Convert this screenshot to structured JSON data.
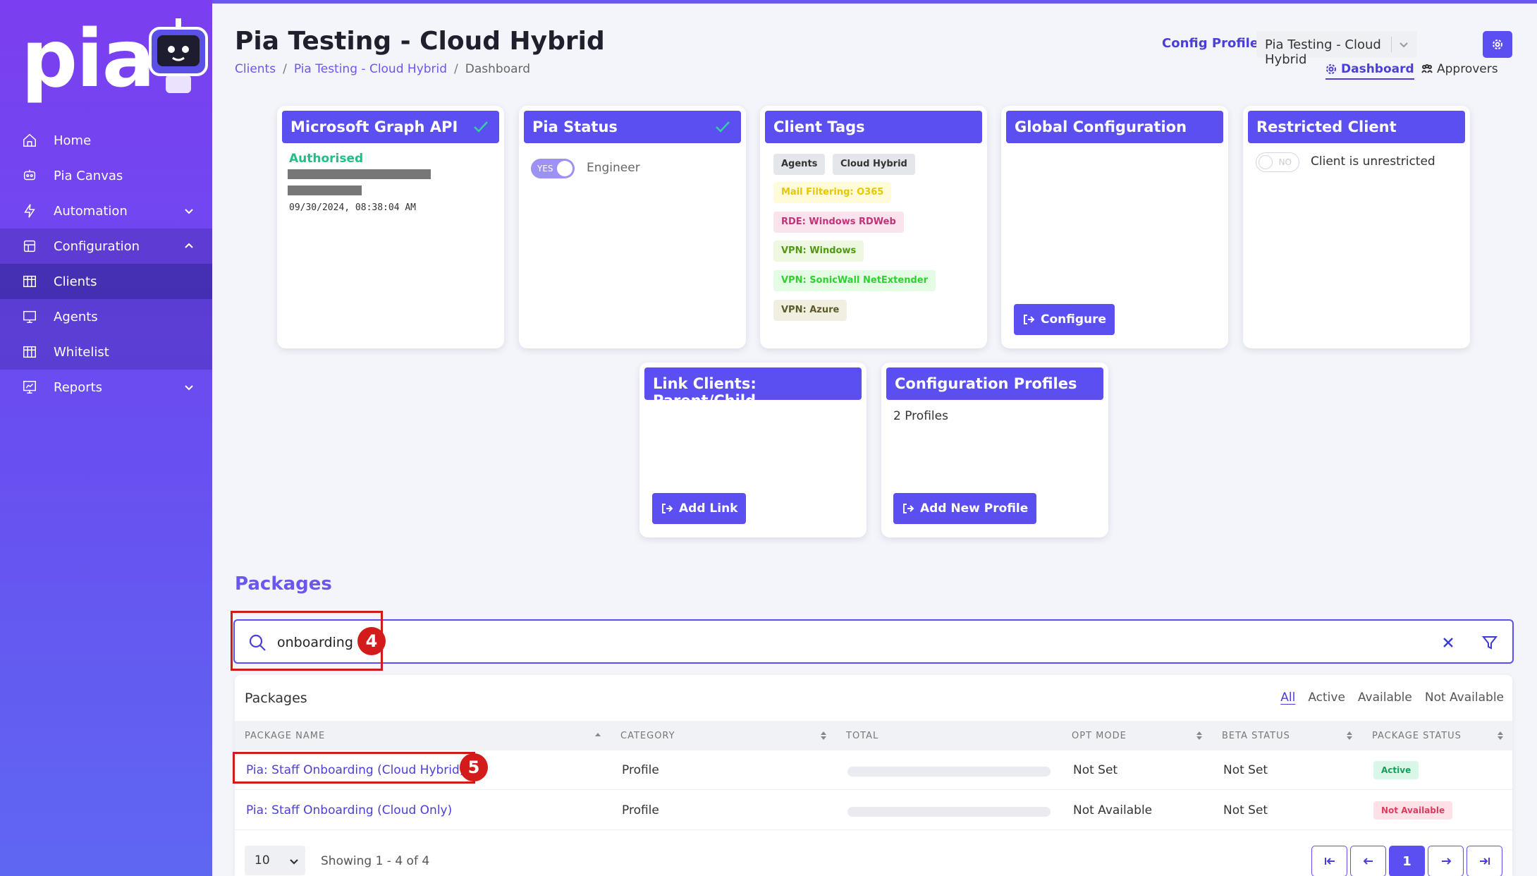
{
  "brand": {
    "logo_text": "pia"
  },
  "sidebar": {
    "items": [
      {
        "label": "Home",
        "icon": "home-icon"
      },
      {
        "label": "Pia Canvas",
        "icon": "canvas-icon"
      },
      {
        "label": "Automation",
        "icon": "bolt-icon",
        "expandable": true
      },
      {
        "label": "Configuration",
        "icon": "config-icon",
        "expanded": true
      },
      {
        "label": "Clients",
        "icon": "grid-icon",
        "active": true
      },
      {
        "label": "Agents",
        "icon": "monitor-icon"
      },
      {
        "label": "Whitelist",
        "icon": "grid-icon"
      },
      {
        "label": "Reports",
        "icon": "report-icon",
        "expandable": true
      }
    ]
  },
  "header": {
    "title": "Pia Testing - Cloud Hybrid",
    "breadcrumb": [
      "Clients",
      "Pia Testing - Cloud Hybrid",
      "Dashboard"
    ],
    "config_profile_label": "Config Profile:",
    "config_profile_value": "Pia Testing - Cloud Hybrid",
    "tabs": [
      "Dashboard",
      "Approvers"
    ]
  },
  "cards": {
    "graph_api": {
      "title": "Microsoft Graph API",
      "status": "Authorised",
      "date": "09/30/2024, 08:38:04 AM"
    },
    "pia_status": {
      "title": "Pia Status",
      "toggle": "YES",
      "role": "Engineer"
    },
    "client_tags": {
      "title": "Client Tags",
      "tags": [
        "Agents",
        "Cloud Hybrid",
        "Mail Filtering: O365",
        "RDE: Windows RDWeb",
        "VPN: Windows",
        "VPN: SonicWall NetExtender",
        "VPN: Azure"
      ]
    },
    "global_config": {
      "title": "Global Configuration",
      "button": "Configure"
    },
    "restricted": {
      "title": "Restricted Client",
      "toggle": "NO",
      "text": "Client is unrestricted"
    },
    "link_clients": {
      "title": "Link Clients: Parent/Child",
      "button": "Add Link"
    },
    "config_profiles": {
      "title": "Configuration Profiles",
      "count": "2 Profiles",
      "button": "Add New Profile"
    }
  },
  "packages": {
    "heading": "Packages",
    "search_value": "onboarding",
    "table_title": "Packages",
    "filters": [
      "All",
      "Active",
      "Available",
      "Not Available"
    ],
    "columns": [
      "Package Name",
      "Category",
      "Total",
      "Opt Mode",
      "Beta Status",
      "Package Status"
    ],
    "rows": [
      {
        "name": "Pia: Staff Onboarding (Cloud Hybrid)",
        "category": "Profile",
        "opt_mode": "Not Set",
        "beta": "Not Set",
        "status": "Active"
      },
      {
        "name": "Pia: Staff Onboarding (Cloud Only)",
        "category": "Profile",
        "opt_mode": "Not Available",
        "beta": "Not Set",
        "status": "Not Available"
      }
    ],
    "per_page": "10",
    "showing": "Showing 1 - 4 of 4",
    "current_page": "1"
  },
  "annotations": [
    "4",
    "5"
  ],
  "colors": {
    "accent": "#5b4ff2",
    "sidebar": "#7b3ff0",
    "success": "#1fbf87",
    "danger": "#d41b1b"
  }
}
